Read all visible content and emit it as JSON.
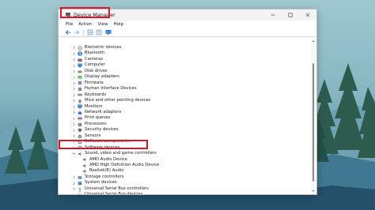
{
  "window": {
    "title": "Device Manager"
  },
  "menu": [
    "File",
    "Action",
    "View",
    "Help"
  ],
  "toolbar": {
    "buttons": [
      "back-icon",
      "forward-icon",
      "properties-icon",
      "help-icon",
      "monitor-icon"
    ]
  },
  "tree": [
    {
      "label": "Biometric devices",
      "icon": "fingerprint-icon",
      "level": 1,
      "expanded": false
    },
    {
      "label": "Bluetooth",
      "icon": "bluetooth-icon",
      "level": 1,
      "expanded": false
    },
    {
      "label": "Cameras",
      "icon": "camera-icon",
      "level": 1,
      "expanded": false
    },
    {
      "label": "Computer",
      "icon": "computer-icon",
      "level": 1,
      "expanded": false
    },
    {
      "label": "Disk drives",
      "icon": "disk-icon",
      "level": 1,
      "expanded": false
    },
    {
      "label": "Display adapters",
      "icon": "display-icon",
      "level": 1,
      "expanded": false
    },
    {
      "label": "Firmware",
      "icon": "firmware-icon",
      "level": 1,
      "expanded": false
    },
    {
      "label": "Human Interface Devices",
      "icon": "hid-icon",
      "level": 1,
      "expanded": false
    },
    {
      "label": "Keyboards",
      "icon": "keyboard-icon",
      "level": 1,
      "expanded": false
    },
    {
      "label": "Mice and other pointing devices",
      "icon": "mouse-icon",
      "level": 1,
      "expanded": false
    },
    {
      "label": "Monitors",
      "icon": "monitor-icon",
      "level": 1,
      "expanded": false
    },
    {
      "label": "Network adapters",
      "icon": "network-icon",
      "level": 1,
      "expanded": false
    },
    {
      "label": "Print queues",
      "icon": "printer-icon",
      "level": 1,
      "expanded": false
    },
    {
      "label": "Processors",
      "icon": "processor-icon",
      "level": 1,
      "expanded": false
    },
    {
      "label": "Security devices",
      "icon": "security-icon",
      "level": 1,
      "expanded": false
    },
    {
      "label": "Sensors",
      "icon": "sensor-icon",
      "level": 1,
      "expanded": false
    },
    {
      "label": "Software components",
      "icon": "software-icon",
      "level": 1,
      "expanded": false
    },
    {
      "label": "Software devices",
      "icon": "software-icon",
      "level": 1,
      "expanded": false
    },
    {
      "label": "Sound, video and game controllers",
      "icon": "speaker-icon",
      "level": 1,
      "expanded": true,
      "selected": true
    },
    {
      "label": "AMD Audio Device",
      "icon": "speaker-icon",
      "level": 2
    },
    {
      "label": "AMD High Definition Audio Device",
      "icon": "speaker-icon",
      "level": 2
    },
    {
      "label": "Realtek(R) Audio",
      "icon": "speaker-icon",
      "level": 2
    },
    {
      "label": "Storage controllers",
      "icon": "storage-icon",
      "level": 1,
      "expanded": false
    },
    {
      "label": "System devices",
      "icon": "system-icon",
      "level": 1,
      "expanded": false
    },
    {
      "label": "Universal Serial Bus controllers",
      "icon": "usb-icon",
      "level": 1,
      "expanded": false
    },
    {
      "label": "Universal Serial Bus devices",
      "icon": "usb-icon",
      "level": 1,
      "expanded": false
    }
  ],
  "colors": {
    "highlight": "#d11a2a",
    "folder_blue": "#3a78c9"
  }
}
